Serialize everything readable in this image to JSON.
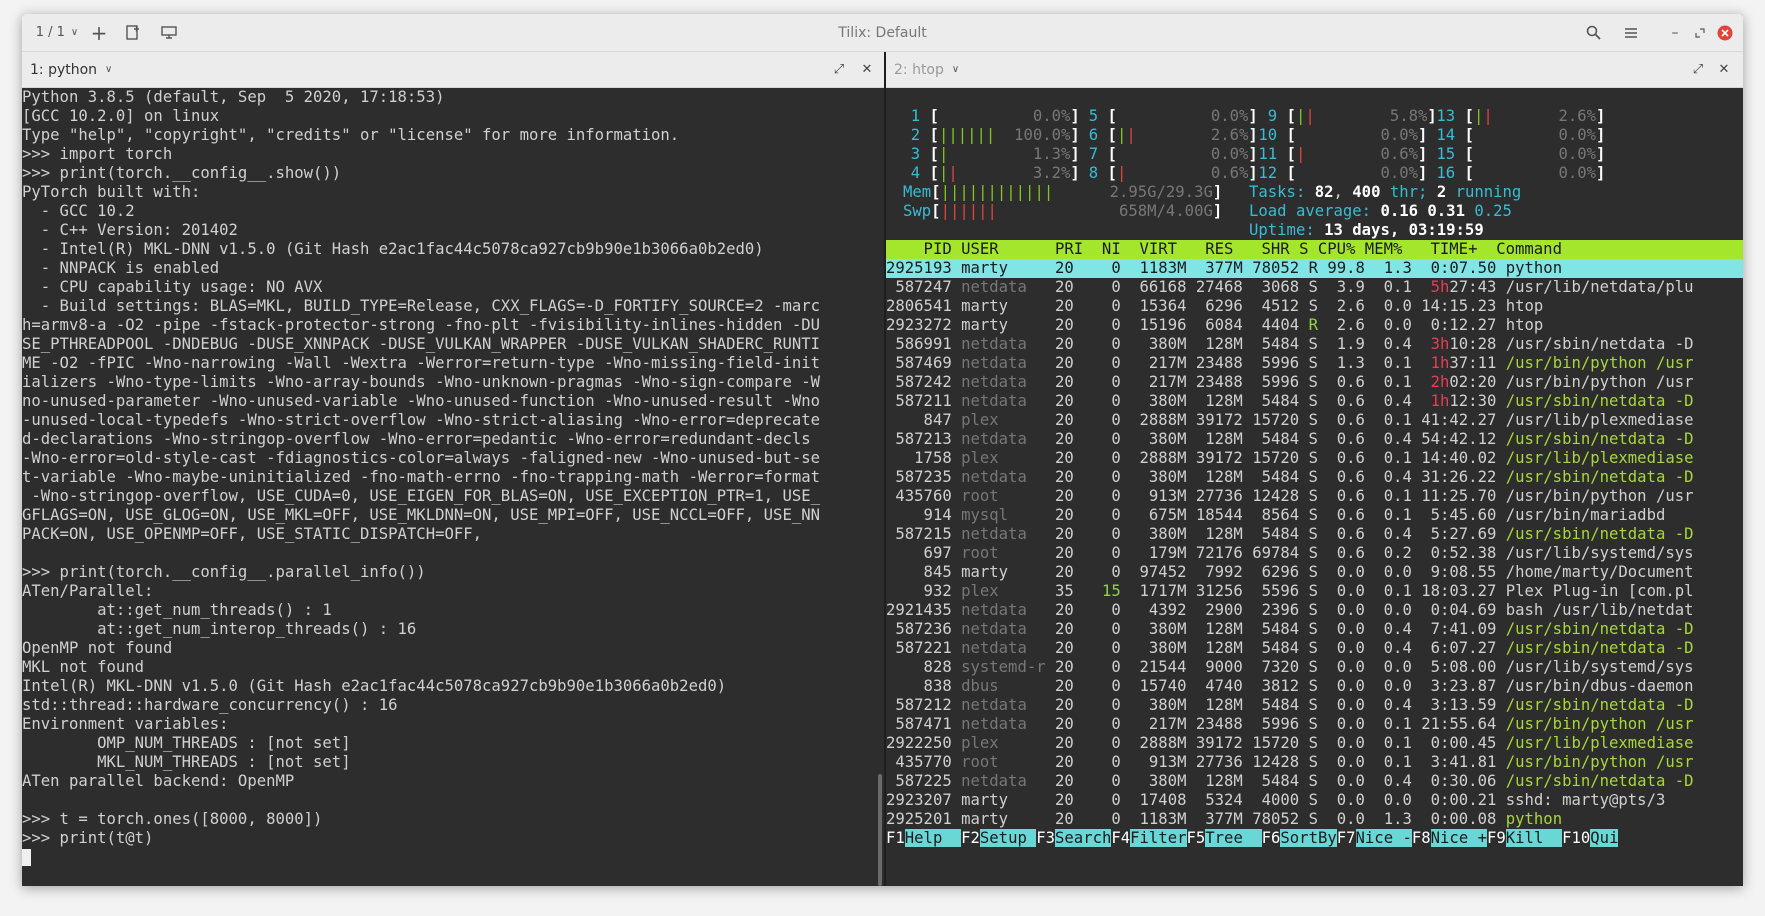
{
  "window": {
    "title": "Tilix: Default",
    "session_counter": "1 / 1"
  },
  "left_pane": {
    "tab_label": "1: python",
    "lines": [
      "Python 3.8.5 (default, Sep  5 2020, 17:18:53)",
      "[GCC 10.2.0] on linux",
      "Type \"help\", \"copyright\", \"credits\" or \"license\" for more information.",
      ">>> import torch",
      ">>> print(torch.__config__.show())",
      "PyTorch built with:",
      "  - GCC 10.2",
      "  - C++ Version: 201402",
      "  - Intel(R) MKL-DNN v1.5.0 (Git Hash e2ac1fac44c5078ca927cb9b90e1b3066a0b2ed0)",
      "  - NNPACK is enabled",
      "  - CPU capability usage: NO AVX",
      "  - Build settings: BLAS=MKL, BUILD_TYPE=Release, CXX_FLAGS=-D_FORTIFY_SOURCE=2 -marc",
      "h=armv8-a -O2 -pipe -fstack-protector-strong -fno-plt -fvisibility-inlines-hidden -DU",
      "SE_PTHREADPOOL -DNDEBUG -DUSE_XNNPACK -DUSE_VULKAN_WRAPPER -DUSE_VULKAN_SHADERC_RUNTI",
      "ME -O2 -fPIC -Wno-narrowing -Wall -Wextra -Werror=return-type -Wno-missing-field-init",
      "ializers -Wno-type-limits -Wno-array-bounds -Wno-unknown-pragmas -Wno-sign-compare -W",
      "no-unused-parameter -Wno-unused-variable -Wno-unused-function -Wno-unused-result -Wno",
      "-unused-local-typedefs -Wno-strict-overflow -Wno-strict-aliasing -Wno-error=deprecate",
      "d-declarations -Wno-stringop-overflow -Wno-error=pedantic -Wno-error=redundant-decls",
      "-Wno-error=old-style-cast -fdiagnostics-color=always -faligned-new -Wno-unused-but-se",
      "t-variable -Wno-maybe-uninitialized -fno-math-errno -fno-trapping-math -Werror=format",
      " -Wno-stringop-overflow, USE_CUDA=0, USE_EIGEN_FOR_BLAS=ON, USE_EXCEPTION_PTR=1, USE_",
      "GFLAGS=ON, USE_GLOG=ON, USE_MKL=OFF, USE_MKLDNN=ON, USE_MPI=OFF, USE_NCCL=OFF, USE_NN",
      "PACK=ON, USE_OPENMP=OFF, USE_STATIC_DISPATCH=OFF,",
      "",
      ">>> print(torch.__config__.parallel_info())",
      "ATen/Parallel:",
      "        at::get_num_threads() : 1",
      "        at::get_num_interop_threads() : 16",
      "OpenMP not found",
      "MKL not found",
      "Intel(R) MKL-DNN v1.5.0 (Git Hash e2ac1fac44c5078ca927cb9b90e1b3066a0b2ed0)",
      "std::thread::hardware_concurrency() : 16",
      "Environment variables:",
      "        OMP_NUM_THREADS : [not set]",
      "        MKL_NUM_THREADS : [not set]",
      "ATen parallel backend: OpenMP",
      "",
      ">>> t = torch.ones([8000, 8000])",
      ">>> print(t@t)"
    ]
  },
  "right_pane": {
    "tab_label": "2: htop",
    "cpus": [
      {
        "n": "1",
        "bars_g": "",
        "bars_r": "",
        "pct": "0.0%"
      },
      {
        "n": "2",
        "bars_g": "||||||",
        "bars_r": "",
        "pct": "100.0%"
      },
      {
        "n": "3",
        "bars_g": "|",
        "bars_r": "",
        "pct": "1.3%"
      },
      {
        "n": "4",
        "bars_g": "|",
        "bars_r": "|",
        "pct": "3.2%"
      },
      {
        "n": "5",
        "bars_g": "",
        "bars_r": "",
        "pct": "0.0%"
      },
      {
        "n": "6",
        "bars_g": "|",
        "bars_r": "|",
        "pct": "2.6%"
      },
      {
        "n": "7",
        "bars_g": "",
        "bars_r": "",
        "pct": "0.0%"
      },
      {
        "n": "8",
        "bars_g": "",
        "bars_r": "|",
        "pct": "0.6%"
      },
      {
        "n": "9",
        "bars_g": "|",
        "bars_r": "|",
        "pct": "5.8%"
      },
      {
        "n": "10",
        "bars_g": "",
        "bars_r": "",
        "pct": "0.0%"
      },
      {
        "n": "11",
        "bars_g": "",
        "bars_r": "|",
        "pct": "0.6%"
      },
      {
        "n": "12",
        "bars_g": "",
        "bars_r": "",
        "pct": "0.0%"
      },
      {
        "n": "13",
        "bars_g": "|",
        "bars_r": "|",
        "pct": "2.6%"
      },
      {
        "n": "14",
        "bars_g": "",
        "bars_r": "",
        "pct": "0.0%"
      },
      {
        "n": "15",
        "bars_g": "",
        "bars_r": "",
        "pct": "0.0%"
      },
      {
        "n": "16",
        "bars_g": "",
        "bars_r": "",
        "pct": "0.0%"
      }
    ],
    "mem": {
      "label": "Mem",
      "bars": "||||||||||||",
      "value": "2.95G/29.3G"
    },
    "swp": {
      "label": "Swp",
      "bars": "||||||",
      "value": "658M/4.00G"
    },
    "tasks": {
      "label": "Tasks:",
      "count": "82",
      "thr_count": "400",
      "thr_label": "thr;",
      "running_count": "2",
      "running_label": "running"
    },
    "load": {
      "label": "Load average:",
      "one": "0.16",
      "five": "0.31",
      "fifteen": "0.25"
    },
    "uptime": {
      "label": "Uptime:",
      "value": "13 days, 03:19:59"
    },
    "columns": "    PID USER      PRI  NI  VIRT   RES   SHR S CPU% MEM%   TIME+  Command",
    "processes": [
      {
        "pid": "2925193",
        "user": "marty",
        "pri": "20",
        "ni": "0",
        "virt": "1183M",
        "res": "377M",
        "shr": "78052",
        "s": "R",
        "cpu": "99.8",
        "mem": "1.3",
        "time_h": "",
        "time": "0:07.50",
        "cmd": "python",
        "sel": true
      },
      {
        "pid": "587247",
        "user": "netdata",
        "pri": "20",
        "ni": "0",
        "virt": "66168",
        "res": "27468",
        "shr": "3068",
        "s": "S",
        "cpu": "3.9",
        "mem": "0.1",
        "time_h": "5h",
        "time": "27:43",
        "cmd": "/usr/lib/netdata/plu"
      },
      {
        "pid": "2806541",
        "user": "marty",
        "pri": "20",
        "ni": "0",
        "virt": "15364",
        "res": "6296",
        "shr": "4512",
        "s": "S",
        "cpu": "2.6",
        "mem": "0.0",
        "time_h": "",
        "time": "14:15.23",
        "cmd": "htop"
      },
      {
        "pid": "2923272",
        "user": "marty",
        "pri": "20",
        "ni": "0",
        "virt": "15196",
        "res": "6084",
        "shr": "4404",
        "s": "R",
        "cpu": "2.6",
        "mem": "0.0",
        "time_h": "",
        "time": "0:12.27",
        "cmd": "htop"
      },
      {
        "pid": "586991",
        "user": "netdata",
        "pri": "20",
        "ni": "0",
        "virt": "380M",
        "res": "128M",
        "shr": "5484",
        "s": "S",
        "cpu": "1.9",
        "mem": "0.4",
        "time_h": "3h",
        "time": "10:28",
        "cmd": "/usr/sbin/netdata -D"
      },
      {
        "pid": "587469",
        "user": "netdata",
        "pri": "20",
        "ni": "0",
        "virt": "217M",
        "res": "23488",
        "shr": "5996",
        "s": "S",
        "cpu": "1.3",
        "mem": "0.1",
        "time_h": "1h",
        "time": "37:11",
        "cmd": "/usr/bin/python /usr",
        "green": true
      },
      {
        "pid": "587242",
        "user": "netdata",
        "pri": "20",
        "ni": "0",
        "virt": "217M",
        "res": "23488",
        "shr": "5996",
        "s": "S",
        "cpu": "0.6",
        "mem": "0.1",
        "time_h": "2h",
        "time": "02:20",
        "cmd": "/usr/bin/python /usr"
      },
      {
        "pid": "587211",
        "user": "netdata",
        "pri": "20",
        "ni": "0",
        "virt": "380M",
        "res": "128M",
        "shr": "5484",
        "s": "S",
        "cpu": "0.6",
        "mem": "0.4",
        "time_h": "1h",
        "time": "12:30",
        "cmd": "/usr/sbin/netdata -D",
        "green": true
      },
      {
        "pid": "847",
        "user": "plex",
        "pri": "20",
        "ni": "0",
        "virt": "2888M",
        "res": "39172",
        "shr": "15720",
        "s": "S",
        "cpu": "0.6",
        "mem": "0.1",
        "time_h": "",
        "time": "41:42.27",
        "cmd": "/usr/lib/plexmediase"
      },
      {
        "pid": "587213",
        "user": "netdata",
        "pri": "20",
        "ni": "0",
        "virt": "380M",
        "res": "128M",
        "shr": "5484",
        "s": "S",
        "cpu": "0.6",
        "mem": "0.4",
        "time_h": "",
        "time": "54:42.12",
        "cmd": "/usr/sbin/netdata -D",
        "green": true
      },
      {
        "pid": "1758",
        "user": "plex",
        "pri": "20",
        "ni": "0",
        "virt": "2888M",
        "res": "39172",
        "shr": "15720",
        "s": "S",
        "cpu": "0.6",
        "mem": "0.1",
        "time_h": "",
        "time": "14:40.02",
        "cmd": "/usr/lib/plexmediase",
        "green": true
      },
      {
        "pid": "587235",
        "user": "netdata",
        "pri": "20",
        "ni": "0",
        "virt": "380M",
        "res": "128M",
        "shr": "5484",
        "s": "S",
        "cpu": "0.6",
        "mem": "0.4",
        "time_h": "",
        "time": "31:26.22",
        "cmd": "/usr/sbin/netdata -D",
        "green": true
      },
      {
        "pid": "435760",
        "user": "root",
        "pri": "20",
        "ni": "0",
        "virt": "913M",
        "res": "27736",
        "shr": "12428",
        "s": "S",
        "cpu": "0.6",
        "mem": "0.1",
        "time_h": "",
        "time": "11:25.70",
        "cmd": "/usr/bin/python /usr"
      },
      {
        "pid": "914",
        "user": "mysql",
        "pri": "20",
        "ni": "0",
        "virt": "675M",
        "res": "18544",
        "shr": "8564",
        "s": "S",
        "cpu": "0.6",
        "mem": "0.1",
        "time_h": "",
        "time": "5:45.60",
        "cmd": "/usr/bin/mariadbd"
      },
      {
        "pid": "587215",
        "user": "netdata",
        "pri": "20",
        "ni": "0",
        "virt": "380M",
        "res": "128M",
        "shr": "5484",
        "s": "S",
        "cpu": "0.6",
        "mem": "0.4",
        "time_h": "",
        "time": "5:27.69",
        "cmd": "/usr/sbin/netdata -D",
        "green": true
      },
      {
        "pid": "697",
        "user": "root",
        "pri": "20",
        "ni": "0",
        "virt": "179M",
        "res": "72176",
        "shr": "69784",
        "s": "S",
        "cpu": "0.6",
        "mem": "0.2",
        "time_h": "",
        "time": "0:52.38",
        "cmd": "/usr/lib/systemd/sys"
      },
      {
        "pid": "845",
        "user": "marty",
        "pri": "20",
        "ni": "0",
        "virt": "97452",
        "res": "7992",
        "shr": "6296",
        "s": "S",
        "cpu": "0.0",
        "mem": "0.0",
        "time_h": "",
        "time": "9:08.55",
        "cmd": "/home/marty/Document"
      },
      {
        "pid": "932",
        "user": "plex",
        "pri": "35",
        "ni": "15",
        "virt": "1717M",
        "res": "31256",
        "shr": "5596",
        "s": "S",
        "cpu": "0.0",
        "mem": "0.1",
        "time_h": "",
        "time": "18:03.27",
        "cmd": "Plex Plug-in [com.pl",
        "nigreen": true
      },
      {
        "pid": "2921435",
        "user": "netdata",
        "pri": "20",
        "ni": "0",
        "virt": "4392",
        "res": "2900",
        "shr": "2396",
        "s": "S",
        "cpu": "0.0",
        "mem": "0.0",
        "time_h": "",
        "time": "0:04.69",
        "cmd": "bash /usr/lib/netdat"
      },
      {
        "pid": "587236",
        "user": "netdata",
        "pri": "20",
        "ni": "0",
        "virt": "380M",
        "res": "128M",
        "shr": "5484",
        "s": "S",
        "cpu": "0.0",
        "mem": "0.4",
        "time_h": "",
        "time": "7:41.09",
        "cmd": "/usr/sbin/netdata -D",
        "green": true
      },
      {
        "pid": "587221",
        "user": "netdata",
        "pri": "20",
        "ni": "0",
        "virt": "380M",
        "res": "128M",
        "shr": "5484",
        "s": "S",
        "cpu": "0.0",
        "mem": "0.4",
        "time_h": "",
        "time": "6:07.27",
        "cmd": "/usr/sbin/netdata -D",
        "green": true
      },
      {
        "pid": "828",
        "user": "systemd-r",
        "pri": "20",
        "ni": "0",
        "virt": "21544",
        "res": "9000",
        "shr": "7320",
        "s": "S",
        "cpu": "0.0",
        "mem": "0.0",
        "time_h": "",
        "time": "5:08.00",
        "cmd": "/usr/lib/systemd/sys"
      },
      {
        "pid": "838",
        "user": "dbus",
        "pri": "20",
        "ni": "0",
        "virt": "15740",
        "res": "4740",
        "shr": "3812",
        "s": "S",
        "cpu": "0.0",
        "mem": "0.0",
        "time_h": "",
        "time": "3:23.87",
        "cmd": "/usr/bin/dbus-daemon"
      },
      {
        "pid": "587212",
        "user": "netdata",
        "pri": "20",
        "ni": "0",
        "virt": "380M",
        "res": "128M",
        "shr": "5484",
        "s": "S",
        "cpu": "0.0",
        "mem": "0.4",
        "time_h": "",
        "time": "3:13.59",
        "cmd": "/usr/sbin/netdata -D",
        "green": true
      },
      {
        "pid": "587471",
        "user": "netdata",
        "pri": "20",
        "ni": "0",
        "virt": "217M",
        "res": "23488",
        "shr": "5996",
        "s": "S",
        "cpu": "0.0",
        "mem": "0.1",
        "time_h": "",
        "time": "21:55.64",
        "cmd": "/usr/bin/python /usr",
        "green": true
      },
      {
        "pid": "2922250",
        "user": "plex",
        "pri": "20",
        "ni": "0",
        "virt": "2888M",
        "res": "39172",
        "shr": "15720",
        "s": "S",
        "cpu": "0.0",
        "mem": "0.1",
        "time_h": "",
        "time": "0:00.45",
        "cmd": "/usr/lib/plexmediase",
        "green": true
      },
      {
        "pid": "435770",
        "user": "root",
        "pri": "20",
        "ni": "0",
        "virt": "913M",
        "res": "27736",
        "shr": "12428",
        "s": "S",
        "cpu": "0.0",
        "mem": "0.1",
        "time_h": "",
        "time": "3:41.81",
        "cmd": "/usr/bin/python /usr",
        "green": true
      },
      {
        "pid": "587225",
        "user": "netdata",
        "pri": "20",
        "ni": "0",
        "virt": "380M",
        "res": "128M",
        "shr": "5484",
        "s": "S",
        "cpu": "0.0",
        "mem": "0.4",
        "time_h": "",
        "time": "0:30.06",
        "cmd": "/usr/sbin/netdata -D",
        "green": true
      },
      {
        "pid": "2923207",
        "user": "marty",
        "pri": "20",
        "ni": "0",
        "virt": "17408",
        "res": "5324",
        "shr": "4000",
        "s": "S",
        "cpu": "0.0",
        "mem": "0.0",
        "time_h": "",
        "time": "0:00.21",
        "cmd": "sshd: marty@pts/3"
      },
      {
        "pid": "2925201",
        "user": "marty",
        "pri": "20",
        "ni": "0",
        "virt": "1183M",
        "res": "377M",
        "shr": "78052",
        "s": "S",
        "cpu": "0.0",
        "mem": "1.3",
        "time_h": "",
        "time": "0:00.08",
        "cmd": "python",
        "green": true
      }
    ],
    "fkeys": [
      {
        "k": "F1",
        "l": "Help  "
      },
      {
        "k": "F2",
        "l": "Setup "
      },
      {
        "k": "F3",
        "l": "Search"
      },
      {
        "k": "F4",
        "l": "Filter"
      },
      {
        "k": "F5",
        "l": "Tree  "
      },
      {
        "k": "F6",
        "l": "SortBy"
      },
      {
        "k": "F7",
        "l": "Nice -"
      },
      {
        "k": "F8",
        "l": "Nice +"
      },
      {
        "k": "F9",
        "l": "Kill  "
      },
      {
        "k": "F10",
        "l": "Qui"
      }
    ]
  },
  "colors": {
    "titlebar_bg": "#ececec",
    "terminal_bg": "#2d2d2d",
    "htop_header": "#a3e62c",
    "htop_selected": "#7fe5e5",
    "close_button": "#e0453a"
  }
}
